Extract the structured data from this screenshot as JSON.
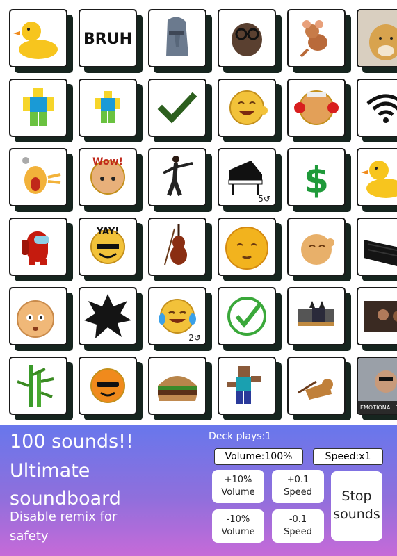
{
  "tiles": [
    {
      "id": "duck",
      "icon": "rubber-duck-icon"
    },
    {
      "id": "bruh",
      "icon": "bruh-text-icon",
      "text": "BRUH"
    },
    {
      "id": "moai",
      "icon": "moai-icon"
    },
    {
      "id": "nerd-rock",
      "icon": "rock-with-glasses-icon"
    },
    {
      "id": "jerry",
      "icon": "cartoon-mouse-icon"
    },
    {
      "id": "doge",
      "icon": "doge-icon"
    },
    {
      "id": "roblox-1",
      "icon": "roblox-character-icon"
    },
    {
      "id": "roblox-2",
      "icon": "roblox-character-small-icon"
    },
    {
      "id": "checkmark",
      "icon": "checkmark-icon"
    },
    {
      "id": "laughing-point",
      "icon": "laughing-emoji-pointing-icon"
    },
    {
      "id": "boxing",
      "icon": "boxing-emoji-icon"
    },
    {
      "id": "wifi",
      "icon": "wifi-disconnected-icon"
    },
    {
      "id": "screaming",
      "icon": "screaming-emoji-icon"
    },
    {
      "id": "wow",
      "icon": "wow-emoji-icon",
      "text": "Wow!"
    },
    {
      "id": "dancer",
      "icon": "dancing-man-icon"
    },
    {
      "id": "piano",
      "icon": "piano-icon",
      "badge": "5"
    },
    {
      "id": "dollar",
      "icon": "dollar-sign-icon",
      "text": "$"
    },
    {
      "id": "duck-2",
      "icon": "rubber-duck-icon"
    },
    {
      "id": "among-us",
      "icon": "among-us-crewmate-icon"
    },
    {
      "id": "yay",
      "icon": "yay-emoji-icon",
      "text": "YAY!"
    },
    {
      "id": "violin",
      "icon": "violin-icon"
    },
    {
      "id": "giggle",
      "icon": "giggling-emoji-icon"
    },
    {
      "id": "snicker",
      "icon": "snickering-emoji-icon"
    },
    {
      "id": "keyboard",
      "icon": "keyboard-icon"
    },
    {
      "id": "thinking",
      "icon": "thinking-emoji-icon"
    },
    {
      "id": "explosion",
      "icon": "black-explosion-icon"
    },
    {
      "id": "crying-laugh",
      "icon": "crying-laughing-emoji-icon",
      "badge": "2"
    },
    {
      "id": "check-circle",
      "icon": "checkmark-circle-icon"
    },
    {
      "id": "batman",
      "icon": "batman-meme-icon"
    },
    {
      "id": "movie-scene",
      "icon": "movie-scene-icon"
    },
    {
      "id": "bamboo",
      "icon": "bamboo-icon"
    },
    {
      "id": "cool",
      "icon": "cool-sunglasses-emoji-icon"
    },
    {
      "id": "burger",
      "icon": "hamburger-icon"
    },
    {
      "id": "minecraft",
      "icon": "minecraft-steve-icon"
    },
    {
      "id": "cheems",
      "icon": "cheems-dog-icon"
    },
    {
      "id": "emotional-damage",
      "icon": "emotional-damage-meme-icon",
      "text": "EMOTIONAL DAMA"
    }
  ],
  "panel": {
    "title_line1": "100 sounds!!",
    "title_line2": "Ultimate",
    "title_line3": "soundboard",
    "remix_line1": "Disable remix for",
    "remix_line2": "safety",
    "deck_plays": "Deck plays:1",
    "volume": "Volume:100%",
    "speed": "Speed:x1",
    "vol_up_a": "+10%",
    "vol_up_b": "Volume",
    "spd_up_a": "+0.1",
    "spd_up_b": "Speed",
    "vol_down_a": "-10%",
    "vol_down_b": "Volume",
    "spd_down_a": "-0.1",
    "spd_down_b": "Speed",
    "stop_a": "Stop",
    "stop_b": "sounds",
    "colors": {
      "gradient_top": "#6877ec",
      "gradient_bottom": "#c66ad8",
      "tile_shadow": "#16251f"
    }
  }
}
